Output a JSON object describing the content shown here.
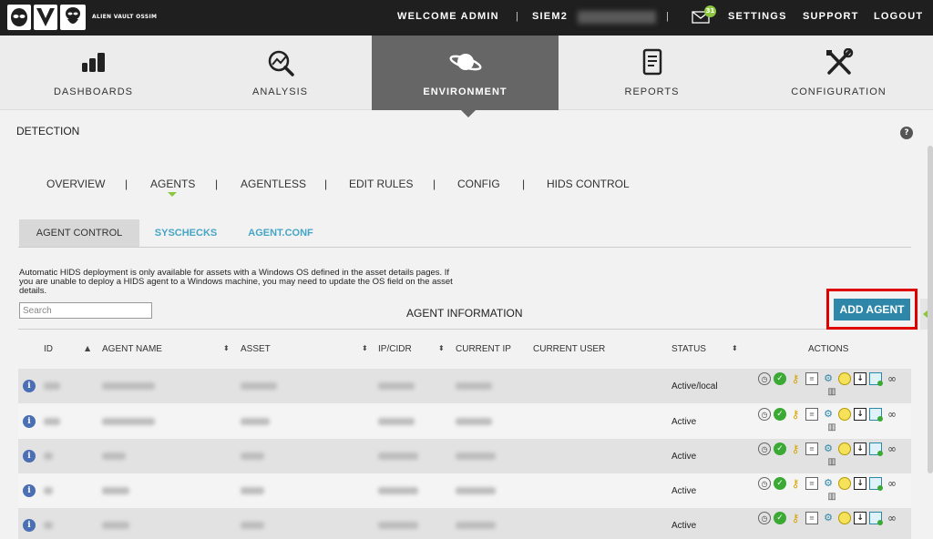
{
  "topbar": {
    "logo_text": "ALIEN VAULT OSSIM",
    "welcome": "WELCOME ADMIN",
    "separator": "|",
    "server": "SIEM2",
    "mail_count": "31",
    "settings": "SETTINGS",
    "support": "SUPPORT",
    "logout": "LOGOUT"
  },
  "mainnav": {
    "dashboards": "DASHBOARDS",
    "analysis": "ANALYSIS",
    "environment": "ENVIRONMENT",
    "reports": "REPORTS",
    "configuration": "CONFIGURATION"
  },
  "page": {
    "title": "DETECTION",
    "help": "?"
  },
  "subnav": {
    "overview": "OVERVIEW",
    "agents": "AGENTS",
    "agentless": "AGENTLESS",
    "edit_rules": "EDIT RULES",
    "config": "CONFIG",
    "hids_control": "HIDS CONTROL",
    "sep": "|"
  },
  "tabs": {
    "agent_control": "AGENT CONTROL",
    "syschecks": "SYSCHECKS",
    "agent_conf": "AGENT.CONF"
  },
  "note": "Automatic HIDS deployment is only available for assets with a Windows OS defined in the asset details pages. If you are unable to deploy a HIDS agent to a Windows machine, you may need to update the OS field on the asset details.",
  "search": {
    "placeholder": "Search"
  },
  "agent_info_title": "AGENT INFORMATION",
  "add_agent": "ADD AGENT",
  "table": {
    "headers": {
      "id": "ID",
      "agent_name": "AGENT NAME",
      "asset": "ASSET",
      "ip_cidr": "IP/CIDR",
      "current_ip": "CURRENT IP",
      "current_user": "CURRENT USER",
      "status": "STATUS",
      "actions": "ACTIONS"
    },
    "sort_up": "▲",
    "sort_both": "⬍",
    "info_glyph": "i",
    "rows": [
      {
        "status": "Active/local"
      },
      {
        "status": "Active"
      },
      {
        "status": "Active"
      },
      {
        "status": "Active"
      },
      {
        "status": "Active"
      }
    ],
    "action_icons": [
      "clock-icon",
      "check-icon",
      "key-icon",
      "document-icon",
      "config-icon",
      "moon-icon",
      "download-icon",
      "image-icon",
      "link-icon",
      "trash-icon"
    ]
  },
  "colors": {
    "topbar_bg": "#1f1f1f",
    "active_nav": "#666666",
    "accent_green": "#8cc63f",
    "add_button": "#2e87a8",
    "highlight_frame": "#e00000"
  }
}
